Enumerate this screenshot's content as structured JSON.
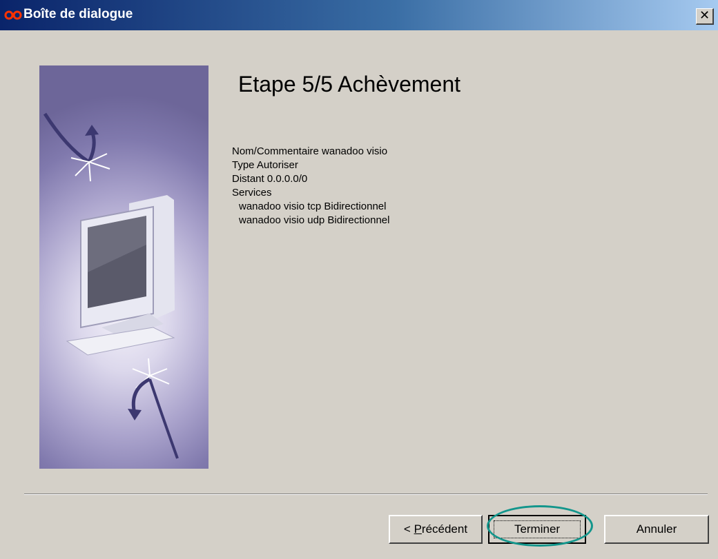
{
  "window": {
    "title": "Boîte de dialogue",
    "close_glyph": "✕"
  },
  "wizard": {
    "heading": "Etape 5/5 Achèvement",
    "summary": {
      "name_line": "Nom/Commentaire wanadoo visio",
      "type_line": "Type Autoriser",
      "remote_line": "Distant 0.0.0.0/0",
      "services_label": "Services",
      "services": [
        "wanadoo visio tcp Bidirectionnel",
        "wanadoo visio udp Bidirectionnel"
      ]
    }
  },
  "buttons": {
    "previous_prefix": "< ",
    "previous_underlined": "P",
    "previous_rest": "récédent",
    "finish": "Terminer",
    "cancel": "Annuler"
  },
  "icons": {
    "app": "infinity-icon",
    "close": "close-icon",
    "illustration": "computer-monitor-illustration"
  },
  "colors": {
    "title_gradient_start": "#0a246a",
    "title_gradient_end": "#a6caf0",
    "dialog_background": "#d4d0c8",
    "highlight_ellipse": "#13968c",
    "side_panel": "#8079ad"
  }
}
